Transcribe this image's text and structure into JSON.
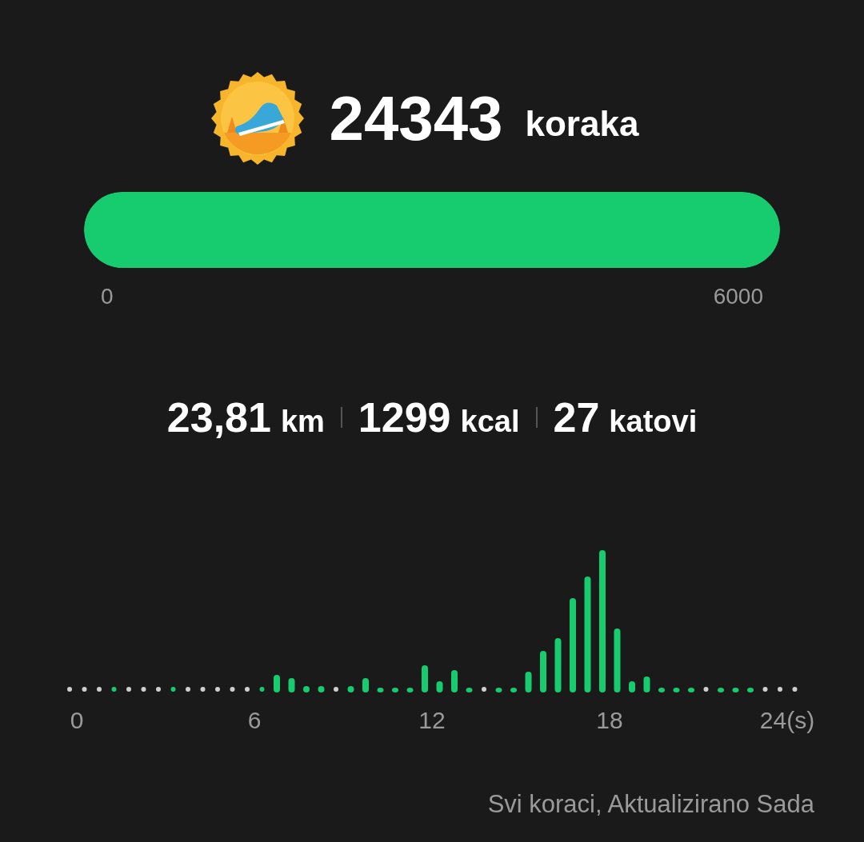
{
  "steps": {
    "value": "24343",
    "unit": "koraka"
  },
  "goal": {
    "level": 1,
    "min_label": "0",
    "max_label": "6000"
  },
  "stats": [
    {
      "value": "23,81",
      "unit": "km"
    },
    {
      "value": "1299",
      "unit": "kcal"
    },
    {
      "value": "27",
      "unit": "katovi"
    }
  ],
  "activity_chart": {
    "axis_labels": [
      "0",
      "6",
      "12",
      "18",
      "24(s)"
    ]
  },
  "footer": "Svi koraci, Aktualizirano Sada"
}
